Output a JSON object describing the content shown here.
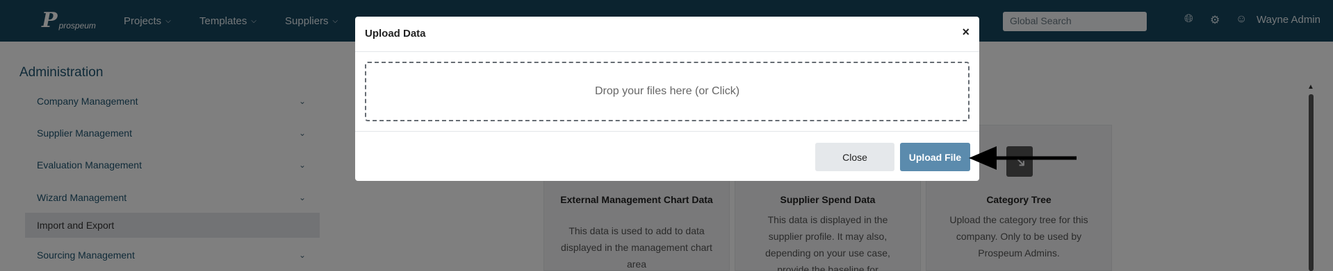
{
  "nav": {
    "logo_word": "prospeum",
    "items": [
      {
        "label": "Projects"
      },
      {
        "label": "Templates"
      },
      {
        "label": "Suppliers"
      }
    ],
    "search_placeholder": "Global Search",
    "user_name": "Wayne Admin",
    "icons": [
      "globe-icon",
      "gear-icon",
      "user-icon"
    ]
  },
  "sidebar": {
    "title": "Administration",
    "items": [
      {
        "label": "Company Management",
        "expandable": true
      },
      {
        "label": "Supplier Management",
        "expandable": true
      },
      {
        "label": "Evaluation Management",
        "expandable": true
      },
      {
        "label": "Wizard Management",
        "expandable": true
      },
      {
        "label": "Import and Export",
        "expandable": false,
        "active": true
      },
      {
        "label": "Sourcing Management",
        "expandable": true
      }
    ]
  },
  "cards": [
    {
      "title": "External Management Chart Data",
      "description": "This data is used to add to data displayed in the management chart area"
    },
    {
      "title": "Supplier Spend Data",
      "description": "This data is displayed in the supplier profile. It may also, depending on your use case, provide the baseline for"
    },
    {
      "title": "Category Tree",
      "description": "Upload the category tree for this company. Only to be used by Prospeum Admins."
    }
  ],
  "modal": {
    "title": "Upload Data",
    "close_symbol": "×",
    "dropzone_text": "Drop your files here (or Click)",
    "close_button": "Close",
    "upload_button": "Upload File"
  },
  "colors": {
    "navbar": "#16465f",
    "primary_button": "#5b8bad",
    "accent_text": "#1e5470"
  }
}
